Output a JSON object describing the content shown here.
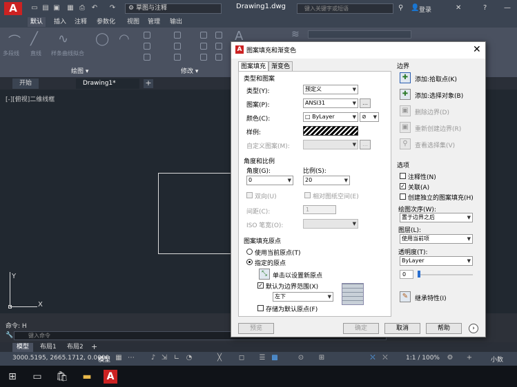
{
  "titlebar": {
    "logo": "A",
    "workspace": "草图与注释",
    "document": "Drawing1.dwg",
    "search_placeholder": "键入关键字或短语",
    "login": "登录"
  },
  "ribbon_tabs": [
    "默认",
    "插入",
    "注释",
    "参数化",
    "视图",
    "管理",
    "输出"
  ],
  "ribbon": {
    "group_draw": "绘图",
    "group_modify": "修改",
    "faded_labels": [
      "多段线",
      "直线",
      "样条曲线拟合"
    ]
  },
  "doc_tabs": [
    "开始",
    "Drawing1*"
  ],
  "viewport_label": "[-][俯视]二维线框",
  "ucs": {
    "x": "X",
    "y": "Y"
  },
  "command": {
    "history": "命令: H",
    "placeholder": "键入命令"
  },
  "layout_tabs": [
    "模型",
    "布局1",
    "布局2"
  ],
  "status": {
    "coords": "3000.5195, 2665.1712, 0.0000",
    "model": "模型",
    "scale": "1:1 / 100%",
    "units": "小数"
  },
  "dialog": {
    "title": "图案填充和渐变色",
    "tabs": [
      "图案填充",
      "渐变色"
    ],
    "type_pattern": {
      "title": "类型和图案",
      "type_label": "类型(Y):",
      "type_value": "预定义",
      "pattern_label": "图案(P):",
      "pattern_value": "ANSI31",
      "color_label": "颜色(C):",
      "color_value": "ByLayer",
      "sample_label": "样例:",
      "custom_label": "自定义图案(M):"
    },
    "angle_scale": {
      "title": "角度和比例",
      "angle_label": "角度(G):",
      "angle_value": "0",
      "scale_label": "比例(S):",
      "scale_value": "20",
      "double_label": "双向(U)",
      "relative_label": "相对图纸空间(E)",
      "spacing_label": "间距(C):",
      "spacing_value": "1",
      "iso_label": "ISO 笔宽(O):"
    },
    "origin": {
      "title": "图案填充原点",
      "use_current": "使用当前原点(T)",
      "specified": "指定的原点",
      "click_set": "单击以设置新原点",
      "default_boundary": "默认为边界范围(X)",
      "position_value": "左下",
      "store_default": "存储为默认原点(F)"
    },
    "boundaries": {
      "title": "边界",
      "add_pick": "添加:拾取点(K)",
      "add_select": "添加:选择对象(B)",
      "remove": "删除边界(D)",
      "recreate": "重新创建边界(R)",
      "view": "查看选择集(V)"
    },
    "options": {
      "title": "选项",
      "annotative": "注释性(N)",
      "associative": "关联(A)",
      "separate": "创建独立的图案填充(H)",
      "draw_order_label": "绘图次序(W):",
      "draw_order_value": "置于边界之后",
      "layer_label": "图层(L):",
      "layer_value": "使用当前项",
      "transparency_label": "透明度(T):",
      "transparency_value": "ByLayer",
      "transparency_num": "0"
    },
    "inherit": "继承特性(I)",
    "buttons": {
      "preview": "预览",
      "ok": "确定",
      "cancel": "取消",
      "help": "帮助"
    }
  }
}
